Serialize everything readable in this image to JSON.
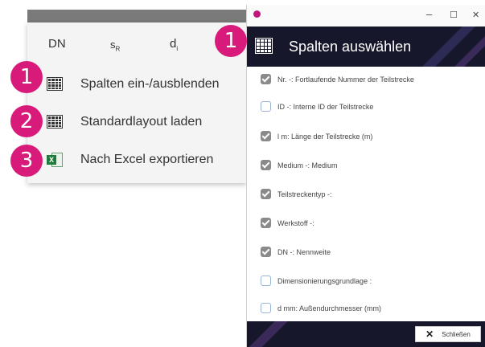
{
  "columns": {
    "dn": "DN",
    "sr_main": "s",
    "sr_sub": "R",
    "di_main": "d",
    "di_sub": "i"
  },
  "menu": {
    "items": [
      {
        "badge": "1",
        "label": "Spalten ein-/ausblenden",
        "icon": "table-icon"
      },
      {
        "badge": "2",
        "label": "Standardlayout laden",
        "icon": "table-icon"
      },
      {
        "badge": "3",
        "label": "Nach Excel exportieren",
        "icon": "excel-icon"
      }
    ]
  },
  "dialog": {
    "badge": "1",
    "window_controls": {
      "minimize": "–",
      "maximize": "☐",
      "close": "✕"
    },
    "title": "Spalten auswählen",
    "close_label": "Schließen",
    "items": [
      {
        "label": "Nr. -: Fortlaufende Nummer der Teilstrecke",
        "checked": true
      },
      {
        "label": "ID -: Interne ID der Teilstrecke",
        "checked": false
      },
      {
        "label": "l m: Länge der Teilstrecke (m)",
        "checked": true
      },
      {
        "label": "Medium -: Medium",
        "checked": true
      },
      {
        "label": "Teilstreckentyp -:",
        "checked": true
      },
      {
        "label": "Werkstoff -:",
        "checked": true
      },
      {
        "label": "DN -: Nennweite",
        "checked": true
      },
      {
        "label": "Dimensionierungsgrundlage  :",
        "checked": false
      },
      {
        "label": "d   mm: Außendurchmesser (mm)",
        "checked": false
      }
    ]
  },
  "colors": {
    "badge": "#d81b7a",
    "header_bg": "#17172b",
    "checked_box": "#8a8a8a"
  }
}
